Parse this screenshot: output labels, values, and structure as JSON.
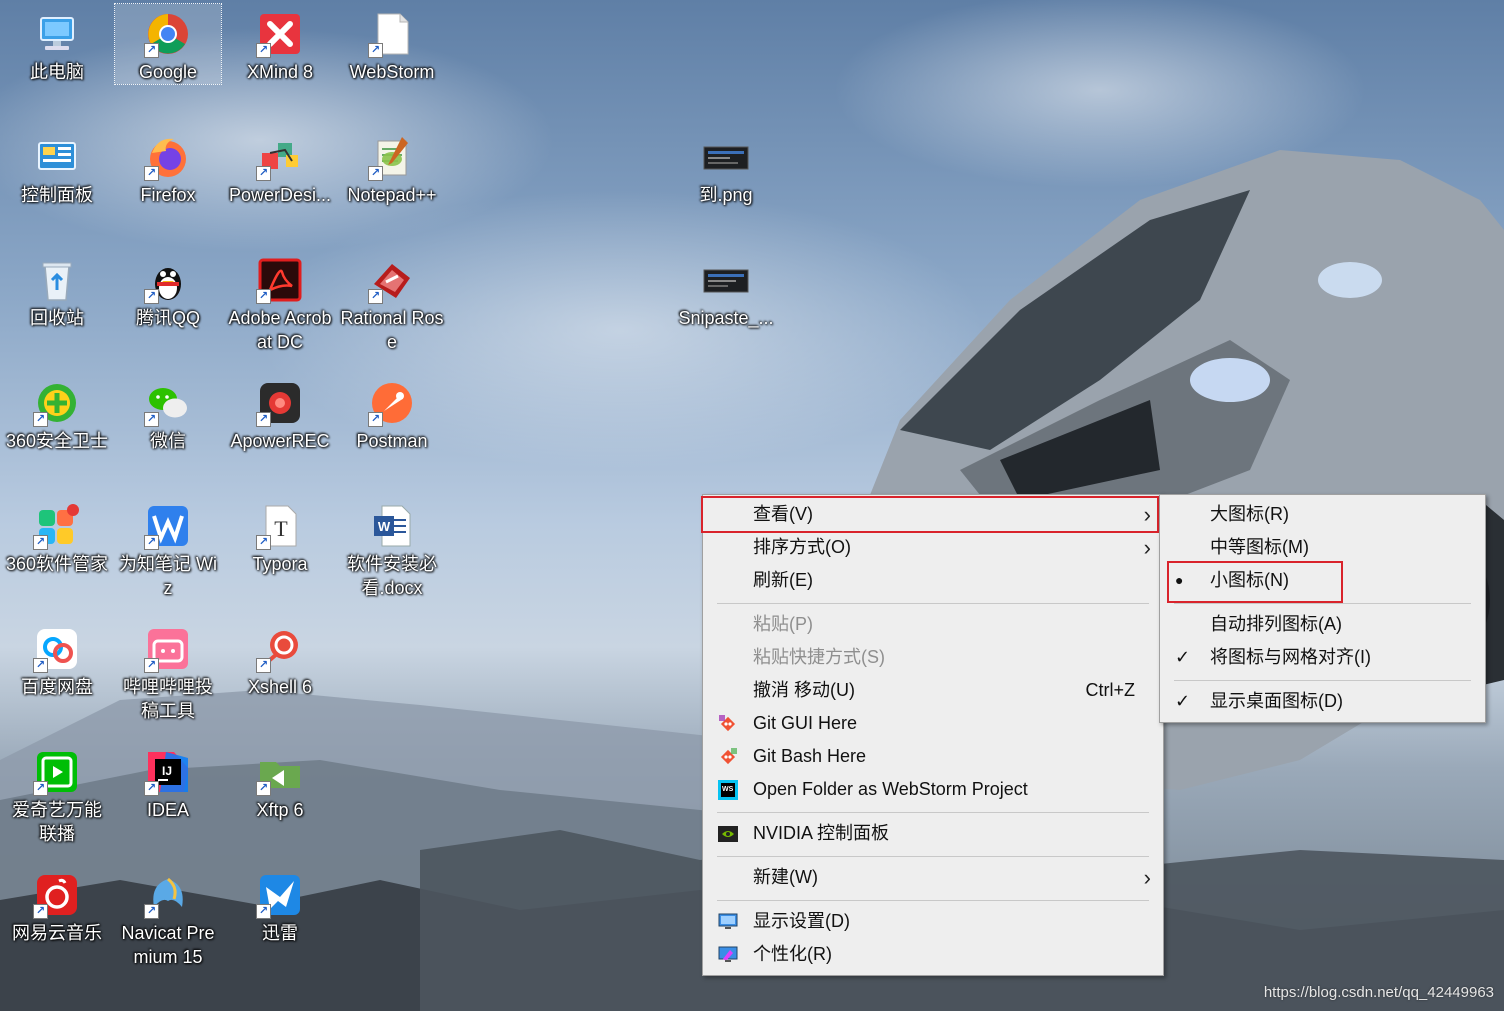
{
  "desktop": {
    "icons": [
      {
        "label": "此电脑"
      },
      {
        "label": "Google"
      },
      {
        "label": "XMind 8"
      },
      {
        "label": "WebStorm"
      },
      {
        "label": "控制面板"
      },
      {
        "label": "Firefox"
      },
      {
        "label": "PowerDesi..."
      },
      {
        "label": "Notepad++"
      },
      {
        "label": "到.png"
      },
      {
        "label": "回收站"
      },
      {
        "label": "腾讯QQ"
      },
      {
        "label": "Adobe Acrobat DC"
      },
      {
        "label": "Rational Rose"
      },
      {
        "label": "Snipaste_..."
      },
      {
        "label": "360安全卫士"
      },
      {
        "label": "微信"
      },
      {
        "label": "ApowerREC"
      },
      {
        "label": "Postman"
      },
      {
        "label": "360软件管家"
      },
      {
        "label": "为知笔记 Wiz"
      },
      {
        "label": "Typora"
      },
      {
        "label": "软件安装必看.docx"
      },
      {
        "label": "百度网盘"
      },
      {
        "label": "哔哩哔哩投稿工具"
      },
      {
        "label": "Xshell 6"
      },
      {
        "label": "爱奇艺万能联播"
      },
      {
        "label": "IDEA"
      },
      {
        "label": "Xftp 6"
      },
      {
        "label": "网易云音乐"
      },
      {
        "label": "Navicat Premium 15"
      },
      {
        "label": "迅雷"
      }
    ]
  },
  "context_menu": {
    "items": [
      {
        "label": "查看(V)"
      },
      {
        "label": "排序方式(O)"
      },
      {
        "label": "刷新(E)"
      },
      {
        "label": "粘贴(P)"
      },
      {
        "label": "粘贴快捷方式(S)"
      },
      {
        "label": "撤消 移动(U)",
        "shortcut": "Ctrl+Z"
      },
      {
        "label": "Git GUI Here"
      },
      {
        "label": "Git Bash Here"
      },
      {
        "label": "Open Folder as WebStorm Project"
      },
      {
        "label": "NVIDIA 控制面板"
      },
      {
        "label": "新建(W)"
      },
      {
        "label": "显示设置(D)"
      },
      {
        "label": "个性化(R)"
      }
    ],
    "chevron": "›"
  },
  "view_submenu": {
    "items": [
      {
        "label": "大图标(R)"
      },
      {
        "label": "中等图标(M)"
      },
      {
        "label": "小图标(N)",
        "mark": "●"
      },
      {
        "label": "自动排列图标(A)"
      },
      {
        "label": "将图标与网格对齐(I)",
        "mark": "✓"
      },
      {
        "label": "显示桌面图标(D)",
        "mark": "✓"
      }
    ]
  },
  "highlight_color": "#d9232b",
  "watermark": "https://blog.csdn.net/qq_42449963"
}
